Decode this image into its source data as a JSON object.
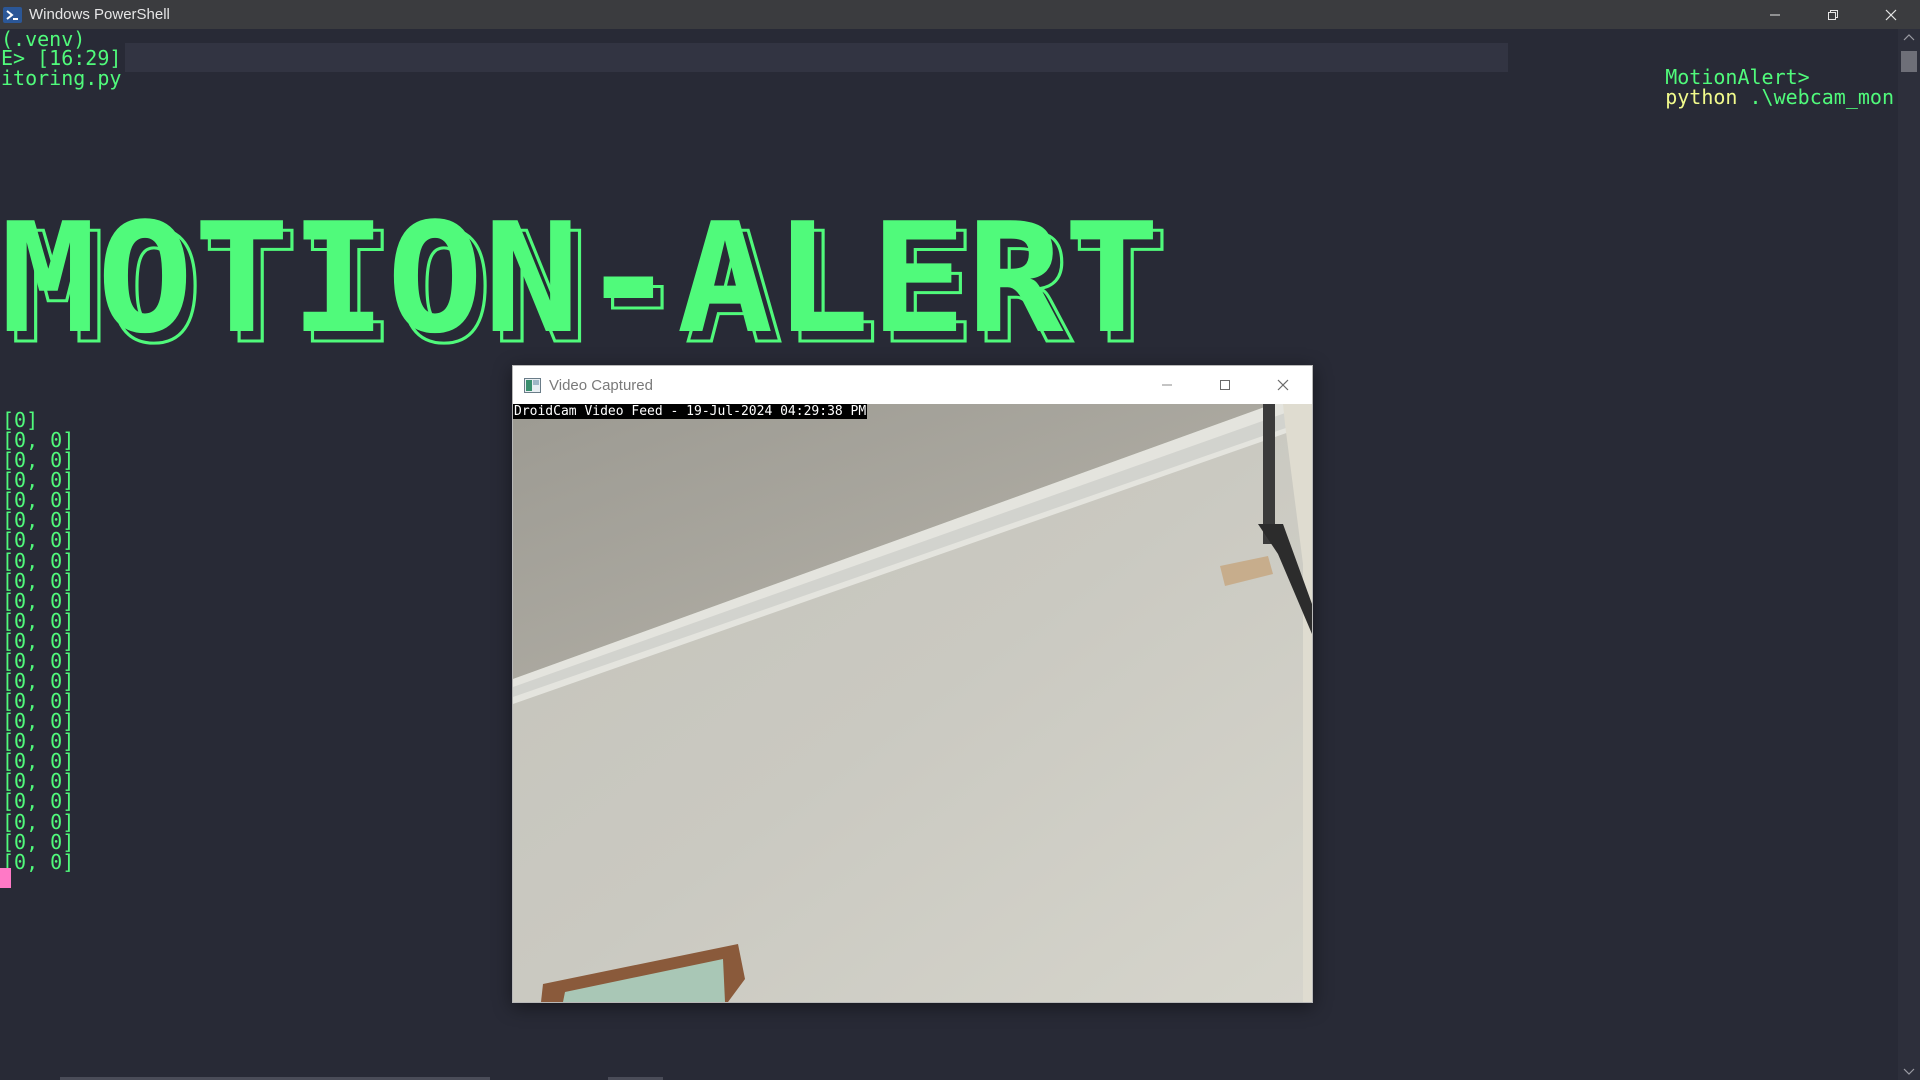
{
  "powershell": {
    "title": "Windows PowerShell",
    "icons": {
      "app": "powershell-icon",
      "minimize": "minimize-icon",
      "restore": "restore-icon",
      "close": "close-icon"
    }
  },
  "terminal": {
    "venv_line": "(.venv)",
    "prompt_prefix": "E> [16:29]",
    "prompt_name": "MotionAlert>",
    "prompt_cmd": "python",
    "prompt_arg": " .\\webcam_mon",
    "prompt_wrap": "itoring.py",
    "banner_text": "MOTION-ALERT",
    "array_first": "[0]",
    "array_lines": [
      "[0, 0]",
      "[0, 0]",
      "[0, 0]",
      "[0, 0]",
      "[0, 0]",
      "[0, 0]",
      "[0, 0]",
      "[0, 0]",
      "[0, 0]",
      "[0, 0]",
      "[0, 0]",
      "[0, 0]",
      "[0, 0]",
      "[0, 0]",
      "[0, 0]",
      "[0, 0]",
      "[0, 0]",
      "[0, 0]",
      "[0, 0]",
      "[0, 0]",
      "[0, 0]",
      "[0, 0]"
    ]
  },
  "video_window": {
    "title": "Video Captured",
    "caption": "DroidCam Video Feed - 19-Jul-2024 04:29:38 PM",
    "icons": {
      "app": "opencv-window-icon",
      "minimize": "minimize-icon",
      "maximize": "maximize-icon",
      "close": "close-icon"
    }
  },
  "colors": {
    "terminal_bg": "#282a36",
    "green": "#50fa7b",
    "yellow": "#f1fa8c",
    "cursor": "#ff79c6"
  }
}
